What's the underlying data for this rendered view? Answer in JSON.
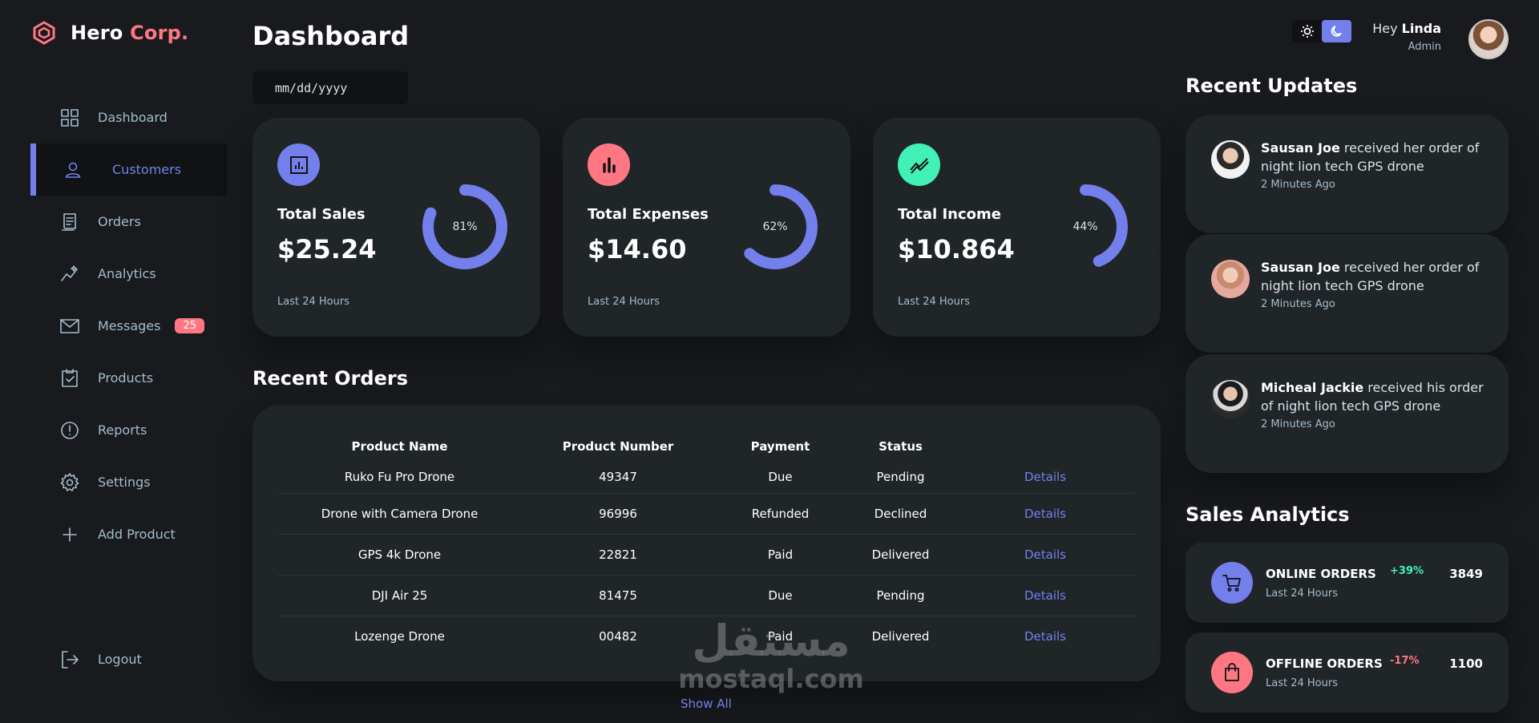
{
  "brand": {
    "name": "Hero",
    "accent": "Corp."
  },
  "sidebar": {
    "items": [
      {
        "label": "Dashboard",
        "icon": "dashboard-grid-icon"
      },
      {
        "label": "Customers",
        "icon": "person-icon"
      },
      {
        "label": "Orders",
        "icon": "receipt-icon"
      },
      {
        "label": "Analytics",
        "icon": "insights-icon"
      },
      {
        "label": "Messages",
        "icon": "mail-icon",
        "badge": "25"
      },
      {
        "label": "Products",
        "icon": "clipboard-check-icon"
      },
      {
        "label": "Reports",
        "icon": "alert-circle-icon"
      },
      {
        "label": "Settings",
        "icon": "gear-icon"
      },
      {
        "label": "Add Product",
        "icon": "plus-icon"
      }
    ],
    "active": "Customers",
    "logout": "Logout"
  },
  "main": {
    "title": "Dashboard",
    "date_placeholder": "mm/dd/yyyy",
    "cards": [
      {
        "title": "Total Sales",
        "value": "$25.24",
        "percent": 81,
        "percent_label": "81%",
        "footer": "Last 24 Hours",
        "icon_color": "#7380ec"
      },
      {
        "title": "Total Expenses",
        "value": "$14.60",
        "percent": 62,
        "percent_label": "62%",
        "footer": "Last 24 Hours",
        "icon_color": "#ff7782"
      },
      {
        "title": "Total Income",
        "value": "$10.864",
        "percent": 44,
        "percent_label": "44%",
        "footer": "Last 24 Hours",
        "icon_color": "#41f1b6"
      }
    ],
    "recent_orders": {
      "title": "Recent Orders",
      "columns": [
        "Product Name",
        "Product Number",
        "Payment",
        "Status"
      ],
      "rows": [
        {
          "name": "Ruko Fu Pro Drone",
          "number": "49347",
          "payment": "Due",
          "status": "Pending",
          "action": "Details"
        },
        {
          "name": "Drone with Camera Drone",
          "number": "96996",
          "payment": "Refunded",
          "status": "Declined",
          "action": "Details"
        },
        {
          "name": "GPS 4k Drone",
          "number": "22821",
          "payment": "Paid",
          "status": "Delivered",
          "action": "Details"
        },
        {
          "name": "DJI Air 25",
          "number": "81475",
          "payment": "Due",
          "status": "Pending",
          "action": "Details"
        },
        {
          "name": "Lozenge Drone",
          "number": "00482",
          "payment": "Paid",
          "status": "Delivered",
          "action": "Details"
        }
      ],
      "show_all": "Show All"
    }
  },
  "header": {
    "greeting": "Hey",
    "user_name": "Linda",
    "role": "Admin"
  },
  "recent_updates": {
    "title": "Recent Updates",
    "items": [
      {
        "name": "Sausan Joe",
        "text": " received her order of night lion tech GPS drone",
        "time": "2 Minutes Ago"
      },
      {
        "name": "Sausan Joe",
        "text": " received her order of night lion tech GPS drone",
        "time": "2 Minutes Ago"
      },
      {
        "name": "Micheal Jackie",
        "text": " received his order of night lion tech GPS drone",
        "time": "2 Minutes Ago"
      }
    ]
  },
  "sales_analytics": {
    "title": "Sales Analytics",
    "items": [
      {
        "title": "ONLINE ORDERS",
        "footer": "Last 24 Hours",
        "change": "+39%",
        "value": "3849",
        "icon": "cart-icon",
        "icon_color": "#7380ec"
      },
      {
        "title": "OFFLINE ORDERS",
        "footer": "Last 24 Hours",
        "change": "-17%",
        "value": "1100",
        "icon": "shopping-bag-icon",
        "icon_color": "#ff7782"
      }
    ]
  },
  "watermark": {
    "arabic": "مستقل",
    "latin": "mostaql.com"
  },
  "colors": {
    "primary": "#7380ec",
    "danger": "#ff7782",
    "success": "#41f1b6",
    "background": "#181a1e",
    "card": "#202528"
  }
}
